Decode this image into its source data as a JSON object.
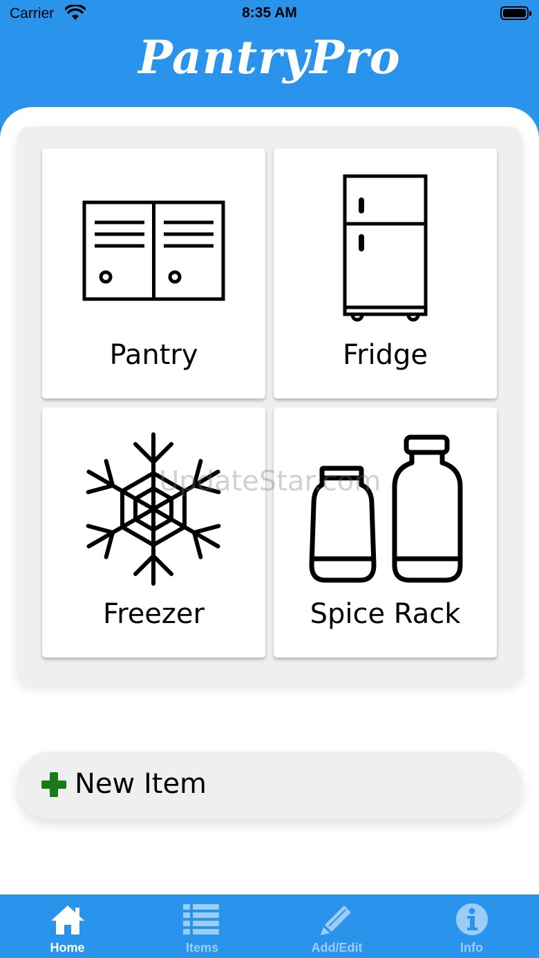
{
  "status_bar": {
    "carrier": "Carrier",
    "time": "8:35 AM"
  },
  "app": {
    "title": "PantryPro"
  },
  "tiles": [
    {
      "label": "Pantry",
      "icon": "cabinet-icon"
    },
    {
      "label": "Fridge",
      "icon": "fridge-icon"
    },
    {
      "label": "Freezer",
      "icon": "snowflake-icon"
    },
    {
      "label": "Spice Rack",
      "icon": "spice-jars-icon"
    }
  ],
  "watermark": "UpdateStar.com",
  "new_item": {
    "label": "New Item",
    "icon": "plus-icon"
  },
  "tabbar": {
    "tabs": [
      {
        "label": "Home",
        "icon": "home-icon",
        "active": true
      },
      {
        "label": "Items",
        "icon": "list-icon",
        "active": false
      },
      {
        "label": "Add/Edit",
        "icon": "pencil-icon",
        "active": false
      },
      {
        "label": "Info",
        "icon": "info-icon",
        "active": false
      }
    ]
  },
  "colors": {
    "brand": "#2a94ec",
    "inactive_tab": "#9ccdf6",
    "plus": "#1a7a1a",
    "panel": "#efefef"
  }
}
